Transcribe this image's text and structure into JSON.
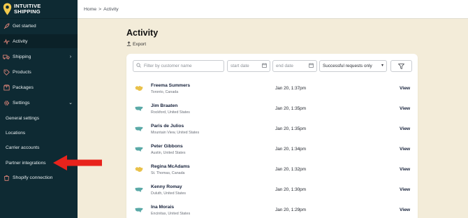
{
  "brand": {
    "line1": "INTUITIVE",
    "line2": "SHIPPING"
  },
  "breadcrumb": {
    "home": "Home",
    "separator": ">",
    "current": "Activity"
  },
  "sidebar": {
    "items": [
      {
        "label": "Get started",
        "icon": "rocket-icon"
      },
      {
        "label": "Activity",
        "icon": "activity-icon"
      },
      {
        "label": "Shipping",
        "icon": "truck-icon"
      },
      {
        "label": "Products",
        "icon": "tag-icon"
      },
      {
        "label": "Packages",
        "icon": "box-icon"
      },
      {
        "label": "Settings",
        "icon": "gear-icon"
      }
    ],
    "settings_sub": [
      {
        "label": "General settings"
      },
      {
        "label": "Locations"
      },
      {
        "label": "Carrier accounts"
      },
      {
        "label": "Partner integrations"
      }
    ],
    "shopify": {
      "label": "Shopify connection",
      "icon": "shopify-icon"
    }
  },
  "main": {
    "title": "Activity",
    "export_label": "Export"
  },
  "filters": {
    "search_placeholder": "Filter by customer name",
    "start_placeholder": "start date",
    "end_placeholder": "end date",
    "status_value": "Successful requests only"
  },
  "rows": [
    {
      "name": "Freema Summers",
      "location": "Toronto, Canada",
      "date": "Jan 20, 1:37pm",
      "action": "View",
      "flag": "canada"
    },
    {
      "name": "Jim Braaten",
      "location": "Rockford, United States",
      "date": "Jan 20, 1:35pm",
      "action": "View",
      "flag": "usa"
    },
    {
      "name": "Paris de Julios",
      "location": "Mountain View, United States",
      "date": "Jan 20, 1:35pm",
      "action": "View",
      "flag": "usa"
    },
    {
      "name": "Peter Gibbons",
      "location": "Austin, United States",
      "date": "Jan 20, 1:34pm",
      "action": "View",
      "flag": "usa"
    },
    {
      "name": "Regina McAdams",
      "location": "St. Thomas, Canada",
      "date": "Jan 20, 1:32pm",
      "action": "View",
      "flag": "canada"
    },
    {
      "name": "Kenny Romay",
      "location": "Duluth, United States",
      "date": "Jan 20, 1:30pm",
      "action": "View",
      "flag": "usa"
    },
    {
      "name": "Ina Morais",
      "location": "Encinitas, United States",
      "date": "Jan 20, 1:29pm",
      "action": "View",
      "flag": "usa"
    }
  ],
  "colors": {
    "sidebar_bg": "#0e2a33",
    "page_bg": "#f3ecd9",
    "accent_icon": "#e98a7d",
    "arrow": "#e8231c",
    "usa_map": "#5aa9a7",
    "canada_map": "#e9c14a"
  }
}
